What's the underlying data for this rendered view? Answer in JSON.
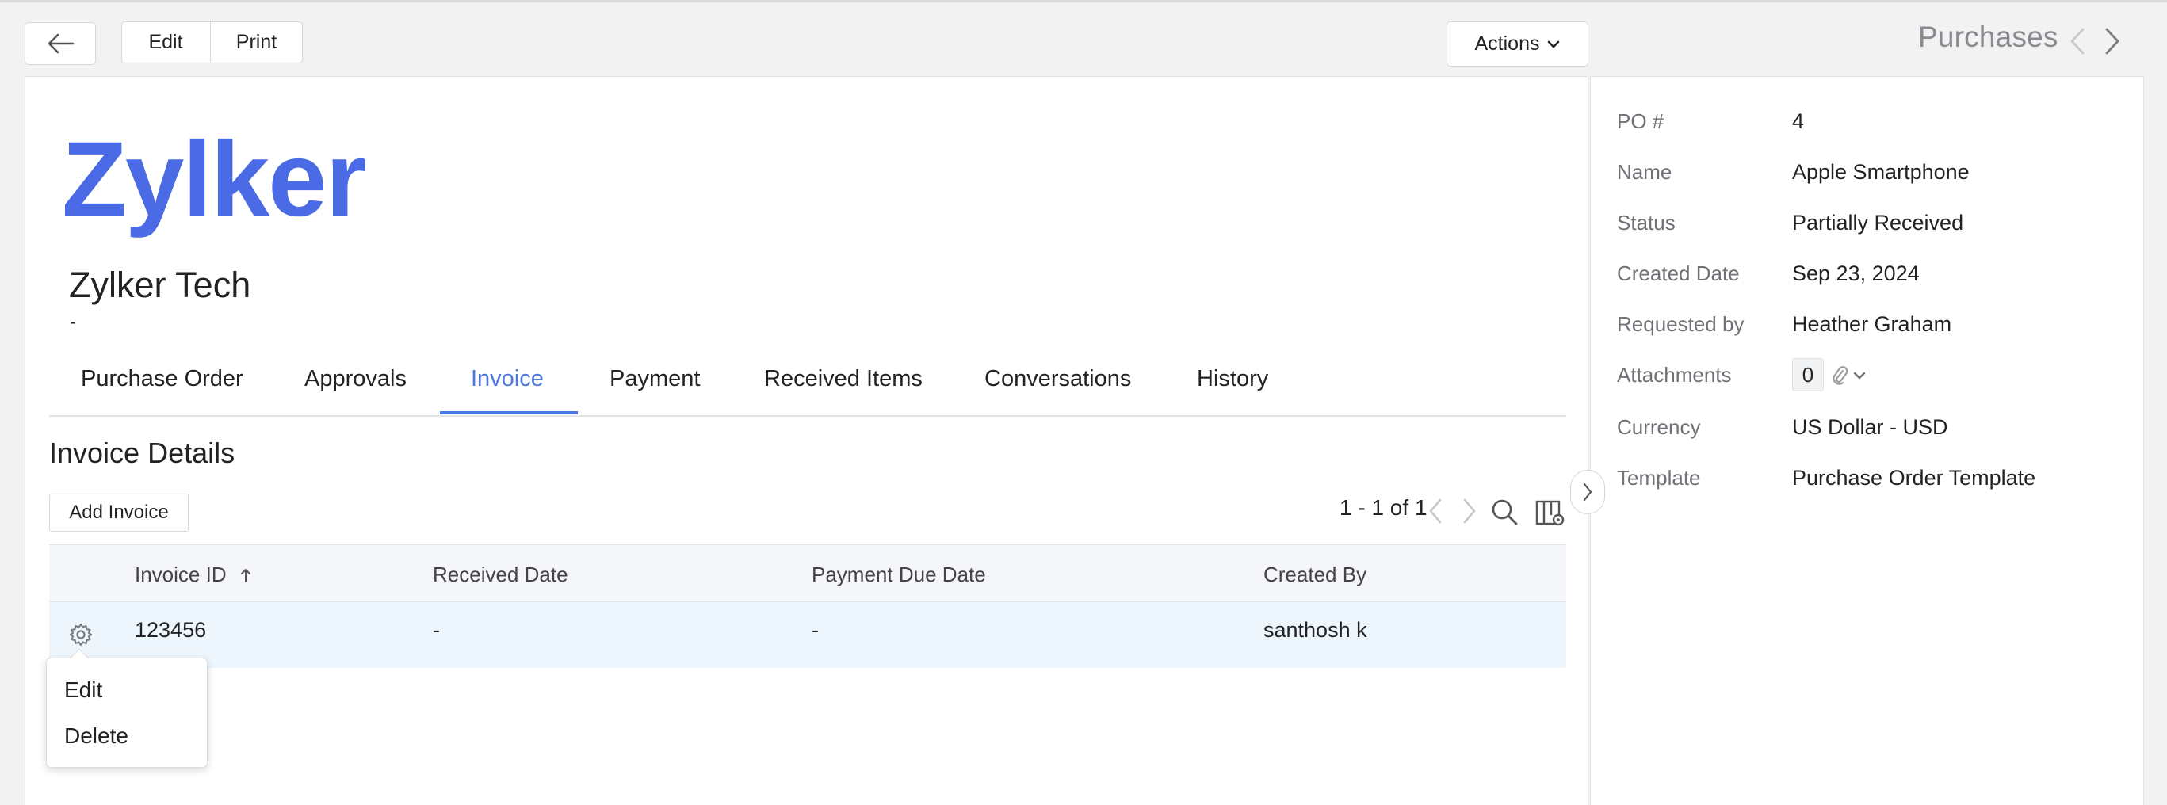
{
  "toolbar": {
    "edit_label": "Edit",
    "print_label": "Print",
    "actions_label": "Actions",
    "module_title": "Purchases"
  },
  "header": {
    "logo_text": "Zylker",
    "company_name": "Zylker Tech",
    "company_subtext": "-"
  },
  "tabs": [
    {
      "label": "Purchase Order"
    },
    {
      "label": "Approvals"
    },
    {
      "label": "Invoice",
      "active": true
    },
    {
      "label": "Payment"
    },
    {
      "label": "Received Items"
    },
    {
      "label": "Conversations"
    },
    {
      "label": "History"
    }
  ],
  "invoice_section": {
    "title": "Invoice Details",
    "add_button_label": "Add Invoice",
    "pagination": "1 - 1 of 1"
  },
  "table": {
    "columns": [
      "Invoice ID",
      "Received Date",
      "Payment Due Date",
      "Created By"
    ],
    "sort_column": "Invoice ID",
    "sort_direction": "asc",
    "rows": [
      {
        "invoice_id": "123456",
        "received_date": "-",
        "payment_due_date": "-",
        "created_by": "santhosh k"
      }
    ]
  },
  "row_menu": {
    "items": [
      "Edit",
      "Delete"
    ]
  },
  "details": [
    {
      "label": "PO #",
      "value": "4"
    },
    {
      "label": "Name",
      "value": "Apple Smartphone"
    },
    {
      "label": "Status",
      "value": "Partially Received"
    },
    {
      "label": "Created Date",
      "value": "Sep 23, 2024"
    },
    {
      "label": "Requested by",
      "value": "Heather Graham"
    },
    {
      "label": "Attachments",
      "value": "0"
    },
    {
      "label": "Currency",
      "value": "US Dollar - USD"
    },
    {
      "label": "Template",
      "value": "Purchase Order Template"
    }
  ],
  "colors": {
    "brand": "#4a6ae6",
    "active_tab": "#4a78e0",
    "row_highlight": "#eef6fd"
  },
  "icons": [
    "arrow-left-icon",
    "chevron-down-icon",
    "chevron-left-icon",
    "chevron-right-icon",
    "search-icon",
    "column-settings-icon",
    "sort-arrow-up-icon",
    "gear-icon",
    "paperclip-icon"
  ]
}
